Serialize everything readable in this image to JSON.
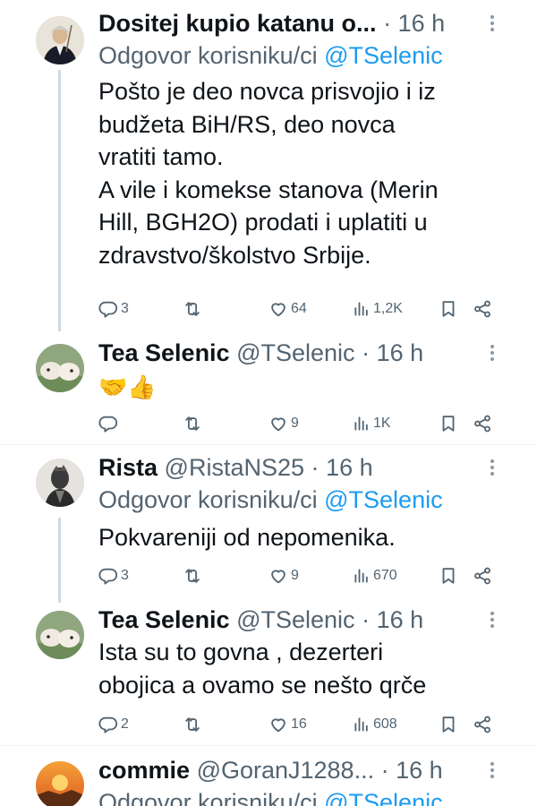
{
  "tweets": [
    {
      "name": "Dositej kupio katanu o...",
      "handle": "",
      "time": "16 h",
      "reply_prefix": "Odgovor korisniku/ci",
      "reply_mention": "@TSelenic",
      "text": "Pošto je deo novca prisvojio i iz\nbudžeta BiH/RS, deo novca\nvratiti tamo.\nA vile i komekse stanova (Merin\nHill, BGH2O) prodati i uplatiti u\nzdravstvo/školstvo Srbije.",
      "stats": {
        "replies": "3",
        "retweets": "",
        "likes": "64",
        "views": "1,2K"
      }
    },
    {
      "name": "Tea Selenic",
      "handle": "@TSelenic",
      "time": "16 h",
      "text": "🤝👍",
      "stats": {
        "replies": "",
        "retweets": "",
        "likes": "9",
        "views": "1K"
      }
    },
    {
      "name": "Rista",
      "handle": "@RistaNS25",
      "time": "16 h",
      "reply_prefix": "Odgovor korisniku/ci",
      "reply_mention": "@TSelenic",
      "text": "Pokvareniji od nepomenika.",
      "stats": {
        "replies": "3",
        "retweets": "",
        "likes": "9",
        "views": "670"
      }
    },
    {
      "name": "Tea Selenic",
      "handle": "@TSelenic",
      "time": "16 h",
      "text": "Ista su to govna , dezerteri\nobojica a ovamo se nešto qrče",
      "stats": {
        "replies": "2",
        "retweets": "",
        "likes": "16",
        "views": "608"
      }
    },
    {
      "name": "commie",
      "handle": "@GoranJ1288...",
      "time": "16 h",
      "reply_prefix": "Odgovor korisniku/ci",
      "reply_mention": "@TSelenic"
    }
  ],
  "separator": "·",
  "icons": [
    "reply-icon",
    "retweet-icon",
    "like-icon",
    "views-icon",
    "bookmark-icon",
    "share-icon",
    "more-icon"
  ],
  "colors": {
    "name": "#0f1419",
    "secondary": "#536471",
    "mention": "#1d9bf0",
    "thread_line": "#cfd9de"
  }
}
